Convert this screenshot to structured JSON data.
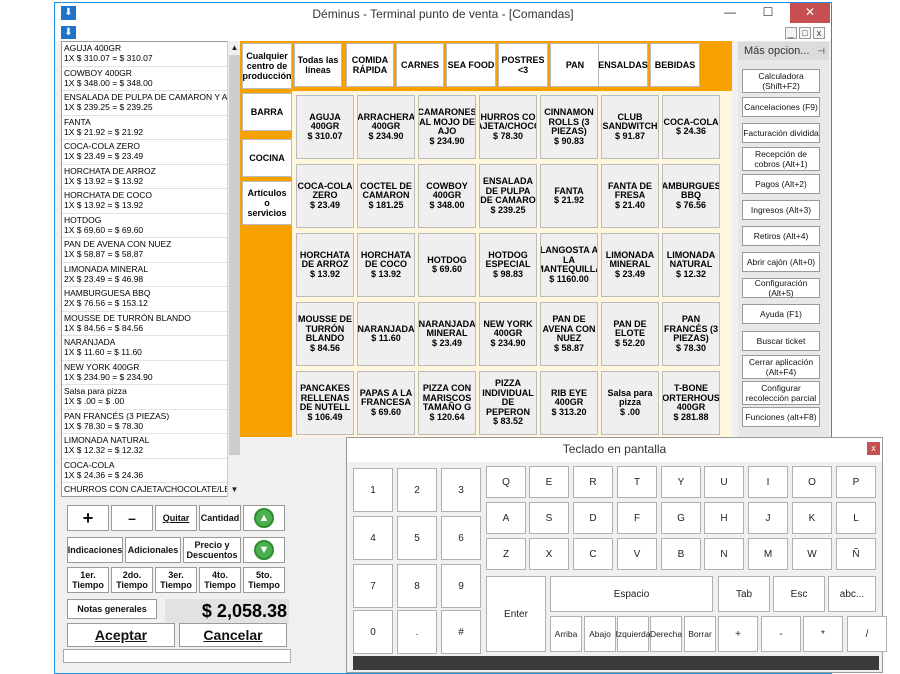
{
  "window": {
    "title": "Déminus - Terminal punto de venta - [Comandas]",
    "min": "—",
    "max": "☐",
    "close": "✕",
    "app_icon": "⬇",
    "mdi": [
      "_",
      "□",
      "x"
    ]
  },
  "order_items": [
    {
      "name": "AGUJA 400GR",
      "price": "1X $ 310.07 = $ 310.07"
    },
    {
      "name": "COWBOY 400GR",
      "price": "1X $ 348.00 = $ 348.00"
    },
    {
      "name": "ENSALADA DE PULPA DE CAMARON Y ATÚN",
      "price": "1X $ 239.25 = $ 239.25"
    },
    {
      "name": "FANTA",
      "price": "1X $ 21.92 = $ 21.92"
    },
    {
      "name": "COCA-COLA ZERO",
      "price": "1X $ 23.49 = $ 23.49"
    },
    {
      "name": "HORCHATA DE ARROZ",
      "price": "1X $ 13.92 = $ 13.92"
    },
    {
      "name": "HORCHATA DE COCO",
      "price": "1X $ 13.92 = $ 13.92"
    },
    {
      "name": "HOTDOG",
      "price": "1X $ 69.60 = $ 69.60"
    },
    {
      "name": "PAN DE AVENA CON NUEZ",
      "price": "1X $ 58.87 = $ 58.87"
    },
    {
      "name": "LIMONADA MINERAL",
      "price": "2X $ 23.49 = $ 46.98"
    },
    {
      "name": "HAMBURGUESA BBQ",
      "price": "2X $ 76.56 = $ 153.12"
    },
    {
      "name": "MOUSSE DE TURRÓN BLANDO",
      "price": "1X $ 84.56 = $ 84.56"
    },
    {
      "name": "NARANJADA",
      "price": "1X $ 11.60 = $ 11.60"
    },
    {
      "name": "NEW YORK 400GR",
      "price": "1X $ 234.90 = $ 234.90"
    },
    {
      "name": "Salsa para pizza",
      "price": "1X $ .00 = $ .00"
    },
    {
      "name": "PAN FRANCÉS (3 PIEZAS)",
      "price": "1X $ 78.30 = $ 78.30"
    },
    {
      "name": "LIMONADA NATURAL",
      "price": "1X $ 12.32 = $ 12.32"
    },
    {
      "name": "COCA-COLA",
      "price": "1X $ 24.36 = $ 24.36"
    },
    {
      "name": "CHURROS CON CAJETA/CHOCOLATE/LECHER",
      "price": ""
    }
  ],
  "buttons": {
    "plus": "+",
    "minus": "–",
    "quitar": "Quitar",
    "cantidad": "Cantidad",
    "indicaciones": "Indicaciones",
    "adicionales": "Adicionales",
    "precio_descuentos": "Precio y Descuentos",
    "t1": "1er. Tiempo",
    "t2": "2do. Tiempo",
    "t3": "3er. Tiempo",
    "t4": "4to. Tiempo",
    "t5": "5to. Tiempo",
    "notas": "Notas generales",
    "aceptar": "Aceptar",
    "cancelar": "Cancelar",
    "up": "▲",
    "down": "▼"
  },
  "total": "$ 2,058.38",
  "categories": [
    "Cualquier centro de producción",
    "BARRA",
    "COCINA",
    "Artículos o servicios"
  ],
  "lines": [
    "Todas las líneas",
    "COMIDA RÁPIDA",
    "CARNES",
    "SEA FOOD",
    "POSTRES <3",
    "PAN",
    "ENSALDAS",
    "BEBIDAS"
  ],
  "products": [
    {
      "name": "AGUJA 400GR",
      "price": "$ 310.07"
    },
    {
      "name": "ARRACHERA 400GR",
      "price": "$ 234.90"
    },
    {
      "name": "CAMARONES AL MOJO DE AJO",
      "price": "$ 234.90"
    },
    {
      "name": "CHURROS CON CAJETA/CHOCOL",
      "price": "$ 78.30"
    },
    {
      "name": "CINNAMON ROLLS (3 PIEZAS)",
      "price": "$ 90.83"
    },
    {
      "name": "CLUB SANDWITCH",
      "price": "$ 91.87"
    },
    {
      "name": "COCA-COLA",
      "price": "$ 24.36"
    },
    {
      "name": "COCA-COLA ZERO",
      "price": "$ 23.49"
    },
    {
      "name": "COCTEL DE CAMARON",
      "price": "$ 181.25"
    },
    {
      "name": "COWBOY 400GR",
      "price": "$ 348.00"
    },
    {
      "name": "ENSALADA DE PULPA DE CAMARO",
      "price": "$ 239.25"
    },
    {
      "name": "FANTA",
      "price": "$ 21.92"
    },
    {
      "name": "FANTA DE FRESA",
      "price": "$ 21.40"
    },
    {
      "name": "HAMBURGUESA BBQ",
      "price": "$ 76.56"
    },
    {
      "name": "HORCHATA DE ARROZ",
      "price": "$ 13.92"
    },
    {
      "name": "HORCHATA DE COCO",
      "price": "$ 13.92"
    },
    {
      "name": "HOTDOG",
      "price": "$ 69.60"
    },
    {
      "name": "HOTDOG ESPECIAL",
      "price": "$ 98.83"
    },
    {
      "name": "LANGOSTA A LA MANTEQUILLA",
      "price": "$ 1160.00"
    },
    {
      "name": "LIMONADA MINERAL",
      "price": "$ 23.49"
    },
    {
      "name": "LIMONADA NATURAL",
      "price": "$ 12.32"
    },
    {
      "name": "MOUSSE DE TURRÓN BLANDO",
      "price": "$ 84.56"
    },
    {
      "name": "NARANJADA",
      "price": "$ 11.60"
    },
    {
      "name": "NARANJADA MINERAL",
      "price": "$ 23.49"
    },
    {
      "name": "NEW YORK 400GR",
      "price": "$ 234.90"
    },
    {
      "name": "PAN DE AVENA CON NUEZ",
      "price": "$ 58.87"
    },
    {
      "name": "PAN DE ELOTE",
      "price": "$ 52.20"
    },
    {
      "name": "PAN FRANCÉS (3 PIEZAS)",
      "price": "$ 78.30"
    },
    {
      "name": "PANCAKES RELLENAS DE NUTELL",
      "price": "$ 106.49"
    },
    {
      "name": "PAPAS A LA FRANCESA",
      "price": "$ 69.60"
    },
    {
      "name": "PIZZA CON MARISCOS TAMAÑO G",
      "price": "$ 120.64"
    },
    {
      "name": "PIZZA INDIVIDUAL DE PEPERON",
      "price": "$ 83.52"
    },
    {
      "name": "RIB EYE 400GR",
      "price": "$ 313.20"
    },
    {
      "name": "Salsa para pizza",
      "price": "$ .00"
    },
    {
      "name": "T-BONE PORTERHOUSE 400GR",
      "price": "$ 281.88"
    }
  ],
  "right_panel": {
    "header": "Más opcion...",
    "pin": "⊣",
    "buttons": [
      "Calculadora (Shift+F2)",
      "Cancelaciones (F9)",
      "Facturación dividida",
      "Recepción de cobros (Alt+1)",
      "Pagos (Alt+2)",
      "Ingresos (Alt+3)",
      "Retiros (Alt+4)",
      "Abrir cajón (Alt+0)",
      "Configuración (Alt+5)",
      "Ayuda (F1)",
      "Buscar ticket",
      "Cerrar aplicación (Alt+F4)",
      "Configurar recolección parcial",
      "Funciones (alt+F8)"
    ]
  },
  "keyboard": {
    "title": "Teclado en pantalla",
    "close": "x",
    "numpad": [
      "1",
      "2",
      "3",
      "4",
      "5",
      "6",
      "7",
      "8",
      "9",
      "0",
      ".",
      "#"
    ],
    "row1": [
      "Q",
      "E",
      "R",
      "T",
      "Y",
      "U",
      "I",
      "O",
      "P"
    ],
    "row2": [
      "A",
      "S",
      "D",
      "F",
      "G",
      "H",
      "J",
      "K",
      "L"
    ],
    "row3": [
      "Z",
      "X",
      "C",
      "V",
      "B",
      "N",
      "M",
      "W",
      "Ñ"
    ],
    "enter": "Enter",
    "space": "Espacio",
    "tab": "Tab",
    "esc": "Esc",
    "abc": "abc...",
    "arrows": [
      "Arriba",
      "Abajo",
      "Izquierda",
      "Derecha",
      "Borrar"
    ],
    "ops": [
      "+",
      "-",
      "*",
      "/"
    ]
  }
}
